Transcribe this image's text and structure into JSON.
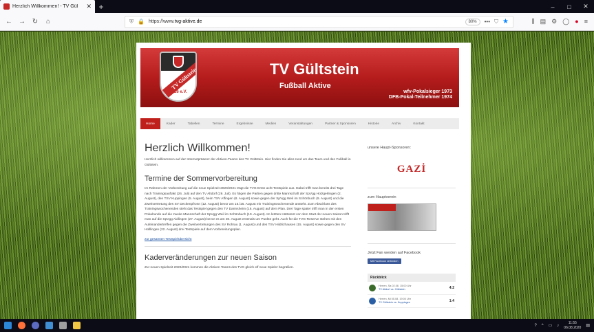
{
  "browser": {
    "tab_title": "Herzlich Willkommen! - TV Gül",
    "url_prefix": "https://www.",
    "url_domain": "tvg-aktive.de",
    "zoom": "80%"
  },
  "header": {
    "title": "TV Gültstein",
    "subtitle": "Fußball Aktive",
    "crest_text": "TV Gültstein",
    "crest_year": "1926 e.V.",
    "right_line1": "wfv-Pokalsieger 1973",
    "right_line2": "DFB-Pokal-Teilnehmer 1974"
  },
  "menu": [
    "Home",
    "Kader",
    "Tabellen",
    "Termine",
    "Ergebnisse",
    "Medien",
    "Veranstaltungen",
    "Partner & Sponsoren",
    "Historie",
    "Archiv",
    "Kontakt"
  ],
  "main": {
    "heading": "Herzlich Willkommen!",
    "intro": "Herzlich willkommen auf der Internetpräsenz der Aktiven-Teams des TV Gültstein. Hier finden Sie alles rund um das Team und den Fußball in Gültstein.",
    "section1_title": "Termine der Sommervorbereitung",
    "section1_text": "Im Rahmen der Vorbereitung auf die neue Spielzeit 2020/2021 trägt die TVG-Erste acht Testspiele aus. Dabei trifft man bereits drei Tage nach Trainingsauftakt (26. Juli) auf den TV Altdorf (29. Juli). Es folgen die Partien gegen dritte Mannschaft der SpVgg Holzgerlingen (2. August), den TSV Kuppingen (5. August), beim TSV Affingen (8. August) sowie gegen der SpVgg Weil im Schönbuch (9. August) und die Zweitvertretung des SV Deckenpfronn (12. August) bevor am 15./16. August ein Trainingswochenende ansteht. Zum Abschluss des Trainingswochenendes steht das Testspiel gegen den TV Darmsheim (16. August) auf dem Plan. Drei Tage später trifft man in der ersten Pokalrunde auf die zweite Mannschaft der SpVgg Weil im Schönbuch (19. August). Im letzten Härtetest vor dem Start der neuen Saison trifft man auf die SpVgg Aidlingen (27. August) bevor es am 30. August erstmals um Punkte geht. Auch für die TVG-Reserve stehen mit den Aufeinandertreffen gegen die Zweitvertretungen des SV Rohrau (1. August) und des TSV Hildrizhausen (15. August) sowie gegen den SV Holllingen (22. August) drei Testspiele auf dem Vorbereitungsplan.",
    "link_text": "zur gesamten Testspielübersicht",
    "section2_title": "Kaderveränderungen zur neuen Saison",
    "section2_text": "Zur neuen Spielzeit 2020/2021 kommen die Aktiven Teams des TVG gleich elf neue Spieler begrüßen."
  },
  "sidebar": {
    "sponsors_label": "unsere Haupt-Sponsoren:",
    "sponsor_name": "GAZİ",
    "hauptverein_label": "zum Hauptverein",
    "facebook_label": "Jetzt Fan werden auf Facebook",
    "facebook_button": "Mit Facebook verbinden",
    "rueckblick_title": "Rückblick",
    "matches": [
      {
        "meta": "Herren, Sa 02.08. 15:00 Uhr",
        "teams": "TV Altdorf vs. Gültstein",
        "score": "4:2",
        "color": "#3a6b2a"
      },
      {
        "meta": "Herren, Mi 05.08. 19:00 Uhr",
        "teams": "TV Gültstein vs. Kuppingen",
        "score": "1:4",
        "color": "#2b5fa5"
      }
    ]
  },
  "taskbar": {
    "time": "11:55",
    "date": "06.08.2020"
  }
}
